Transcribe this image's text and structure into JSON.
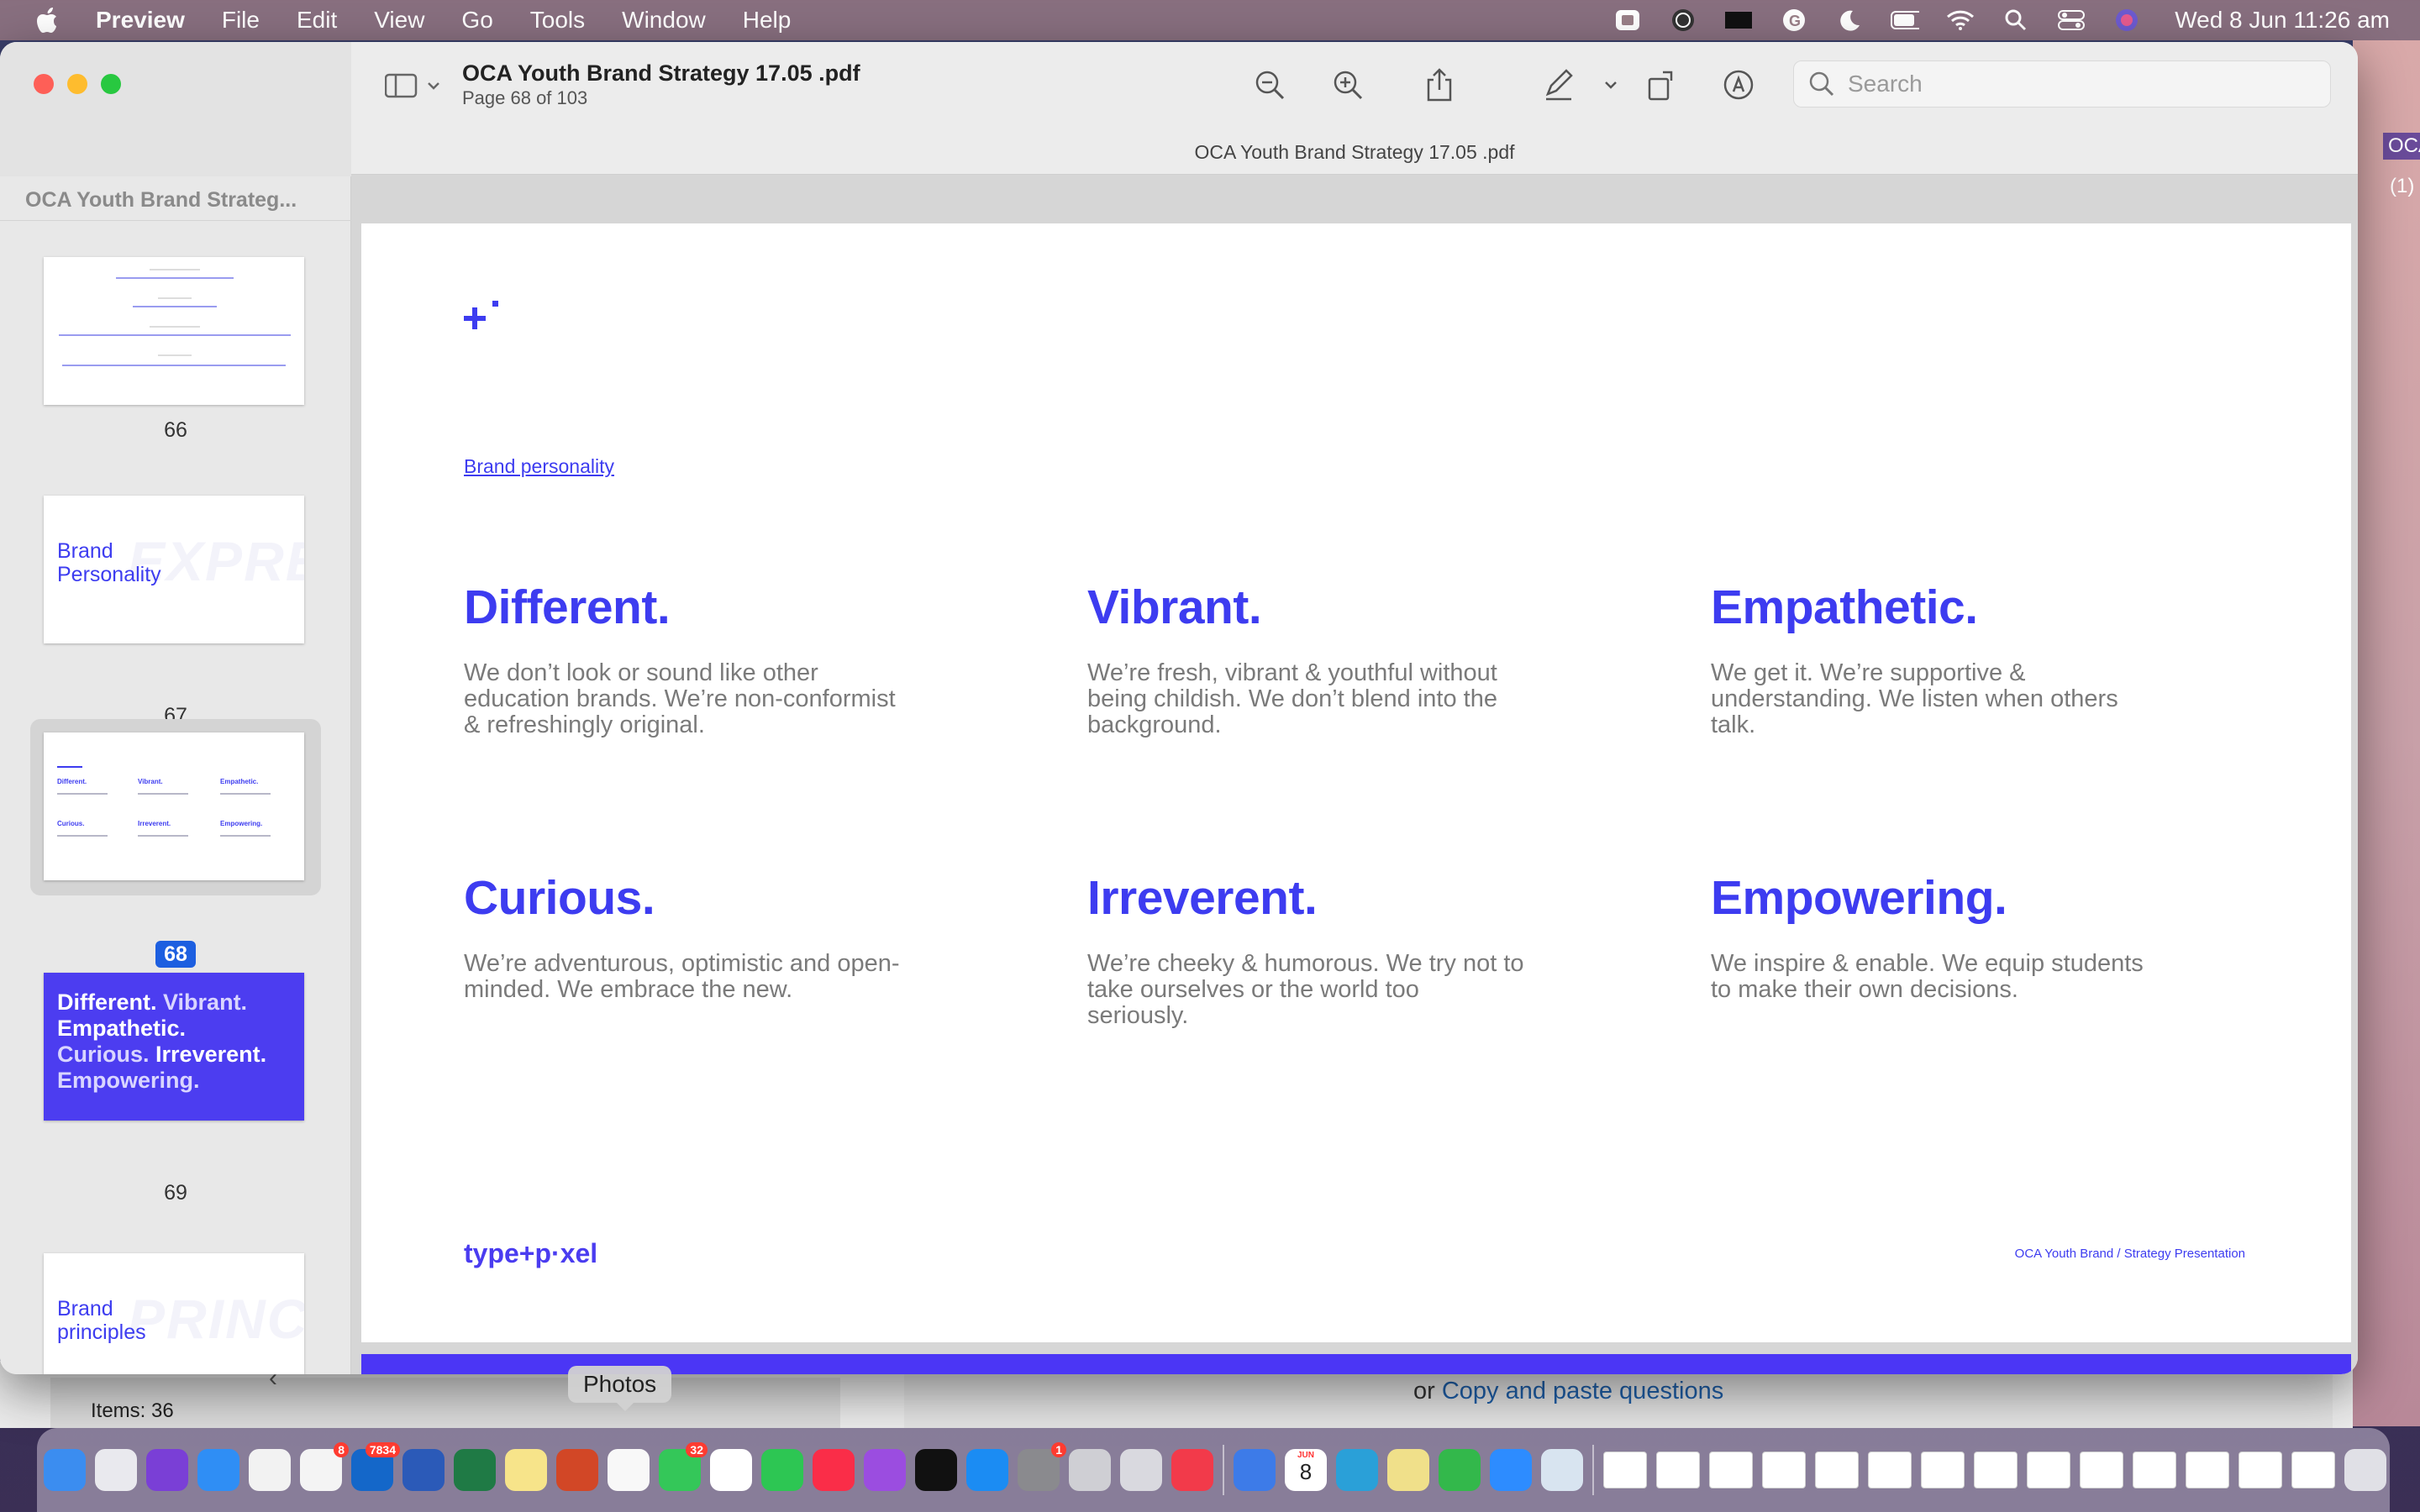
{
  "menubar": {
    "app_name": "Preview",
    "items": [
      "File",
      "Edit",
      "View",
      "Go",
      "Tools",
      "Window",
      "Help"
    ],
    "clock": "Wed 8 Jun  11:26 am"
  },
  "window": {
    "doc_title": "OCA Youth Brand Strategy 17.05 .pdf",
    "page_indicator": "Page 68 of 103",
    "tab_title": "OCA Youth Brand Strategy 17.05 .pdf",
    "search_placeholder": "Search"
  },
  "sidebar": {
    "title": "OCA Youth Brand Strateg...",
    "thumbs": [
      {
        "num": "66"
      },
      {
        "num": "67",
        "heading": "Brand Personality",
        "bg_word": "EXPRESSI"
      },
      {
        "num": "68",
        "selected": true
      },
      {
        "num": "69",
        "words": [
          "Different.",
          "Vibrant.",
          "Empathetic.",
          "Curious.",
          "Irreverent.",
          "Empowering."
        ]
      },
      {
        "num": "",
        "heading": "Brand principles",
        "bg_word": "PRINCIPLES"
      }
    ]
  },
  "page": {
    "section_link": "Brand personality",
    "traits": [
      {
        "title": "Different.",
        "text": "We don’t look or sound like other education brands. We’re non-conformist & refreshingly original."
      },
      {
        "title": "Vibrant.",
        "text": "We’re fresh, vibrant & youthful without being childish. We don’t blend into the background."
      },
      {
        "title": "Empathetic.",
        "text": "We get it. We’re supportive & understanding. We listen when others talk."
      },
      {
        "title": "Curious.",
        "text": "We’re adventurous, optimistic and open-minded.  We embrace the new."
      },
      {
        "title": "Irreverent.",
        "text": "We’re cheeky & humorous. We try not to take ourselves or the world too seriously."
      },
      {
        "title": "Empowering.",
        "text": "We inspire & enable. We equip students to make their own decisions."
      }
    ],
    "footer_logo": "type+p·xel",
    "footer_right": "OCA Youth Brand / Strategy Presentation"
  },
  "background": {
    "items_count": "Items: 36",
    "copy_prefix": "or",
    "copy_link": "Copy and paste questions",
    "right_tag": "OCA",
    "right_count": "(1)"
  },
  "dock": {
    "tooltip": "Photos",
    "apps": [
      {
        "name": "finder",
        "color": "#3b8df0"
      },
      {
        "name": "launchpad",
        "color": "#e9e9ee"
      },
      {
        "name": "siri",
        "color": "#7a3fd6"
      },
      {
        "name": "safari",
        "color": "#2f8ef5"
      },
      {
        "name": "chrome",
        "color": "#f2f2f2"
      },
      {
        "name": "reminders",
        "color": "#f4f4f4",
        "badge": "8"
      },
      {
        "name": "outlook",
        "color": "#1467c9",
        "badge": "7834"
      },
      {
        "name": "word",
        "color": "#2b5ab8"
      },
      {
        "name": "excel",
        "color": "#1f7a45"
      },
      {
        "name": "notes",
        "color": "#f7e48a"
      },
      {
        "name": "powerpoint",
        "color": "#d24726"
      },
      {
        "name": "photos",
        "color": "#f8f8f8"
      },
      {
        "name": "messages",
        "color": "#34c759",
        "badge": "32"
      },
      {
        "name": "slack",
        "color": "#ffffff"
      },
      {
        "name": "facetime",
        "color": "#2dc653"
      },
      {
        "name": "music",
        "color": "#fa2d48"
      },
      {
        "name": "podcasts",
        "color": "#9b4de0"
      },
      {
        "name": "tv",
        "color": "#111111"
      },
      {
        "name": "app-store",
        "color": "#1b8cf3"
      },
      {
        "name": "system-preferences",
        "color": "#8a8a8e",
        "badge": "1"
      },
      {
        "name": "help",
        "color": "#cfcfd4"
      },
      {
        "name": "quicktime",
        "color": "#d9d9df"
      },
      {
        "name": "news",
        "color": "#f23a4a"
      }
    ],
    "apps_after_sep": [
      {
        "name": "network",
        "color": "#3d7be8"
      },
      {
        "name": "calendar",
        "color": "#ffffff"
      },
      {
        "name": "browser",
        "color": "#2aa0d8"
      },
      {
        "name": "stickies",
        "color": "#f0e08a"
      },
      {
        "name": "numbers",
        "color": "#33b84b"
      },
      {
        "name": "zoom",
        "color": "#2d8cff"
      },
      {
        "name": "preview",
        "color": "#d8e4f0"
      }
    ],
    "calendar_month": "JUN",
    "calendar_day": "8"
  }
}
